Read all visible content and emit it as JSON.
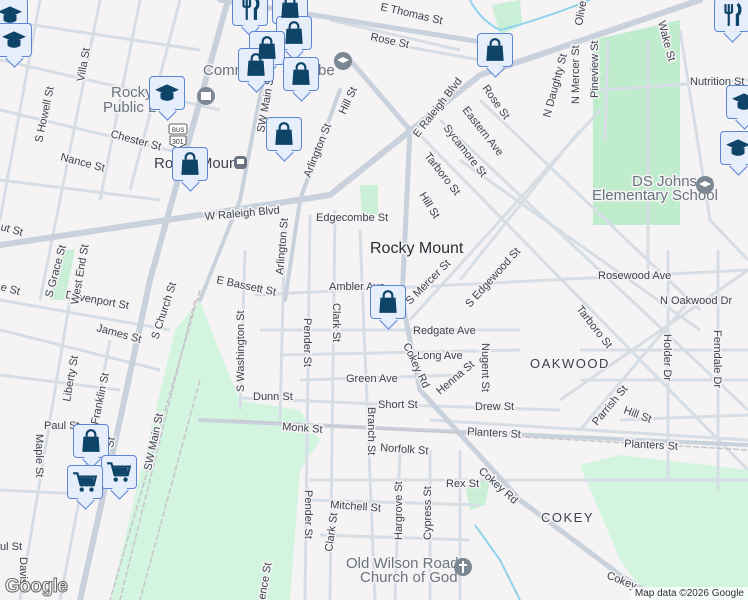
{
  "colors": {
    "background": "#f5f3f3",
    "park": "#c9f0d6",
    "road": "#d3dbe3",
    "major_road": "#c8d1da",
    "water": "#8fd3ee",
    "pin_fill": "#e6edfb",
    "pin_border": "#5b86d6",
    "icon": "#0d4468"
  },
  "place": "Rocky Mount",
  "neighborhoods": {
    "oakwood": "OAKWOOD",
    "cokey": "COKEY"
  },
  "pois": {
    "school_line1": "DS Johnson",
    "school_line2": "Elementary School",
    "church_line1": "Old Wilson Road",
    "church_line2": "Church of God",
    "library_line1": "Rocky",
    "library_line2": "Public L",
    "station": "Rocky Mount",
    "community": "Comm",
    "community_end": "be"
  },
  "route_shield": {
    "top": "BUS",
    "number": "301"
  },
  "streets": {
    "e_thomas": "E Thomas St",
    "rose1": "Rose St",
    "rose2": "Rose St",
    "e_raleigh": "E Raleigh Blvd",
    "eastern": "Eastern Ave",
    "sycamore": "Sycamore St",
    "tarboro1": "Tarboro St",
    "tarboro2": "Tarboro St",
    "hill1": "Hill St",
    "hill2": "Hill St",
    "hill3": "Hill St",
    "daughty": "N Daughty St",
    "n_mercer": "N Mercer St",
    "olive": "Olive St",
    "pineview": "Pineview St",
    "wake": "Wake St",
    "nutrition": "Nutrition St",
    "rosewood": "Rosewood Ave",
    "n_oakwood": "N Oakwood Dr",
    "s_mercer": "S Mercer St",
    "s_edgewood": "S Edgewood St",
    "edgecombe": "Edgecombe St",
    "w_raleigh": "W Raleigh Blvd",
    "arlington1": "Arlington St",
    "arlington2": "Arlington St",
    "chester": "Chester St",
    "nance": "Nance St",
    "s_howell": "S Howell St",
    "villa": "Villa St",
    "sw_main1": "SW Main St",
    "e_bassett": "E Bassett St",
    "ambler": "Ambler Ave",
    "davenport": "Davenport St",
    "james": "James St",
    "s_grace": "S Grace St",
    "west_end": "West End St",
    "s_washington": "S Washington St",
    "pender1": "Pender St",
    "clark1": "Clark St",
    "redgate": "Redgate Ave",
    "long": "Long Ave",
    "green": "Green Ave",
    "henna": "Henna St",
    "nugent": "Nugent St",
    "dunn": "Dunn St",
    "short": "Short St",
    "drew": "Drew St",
    "parrish": "Parrish St",
    "monk": "Monk St",
    "norfolk": "Norfolk St",
    "planters1": "Planters St",
    "planters2": "Planters St",
    "branch": "Branch St",
    "cokey1": "Cokey Rd",
    "cokey2": "Cokey Rd",
    "cokey3": "Cokey",
    "rex": "Rex St",
    "mitchell": "Mitchell St",
    "pender2": "Pender St",
    "clark2": "Clark St",
    "hargrove": "Hargrove St",
    "cypress": "Cypress St",
    "liberty": "Liberty St",
    "franklin": "Franklin St",
    "paul": "Paul St",
    "maple": "Maple St",
    "sw_main2": "SW Main St",
    "s_church": "S Church St",
    "holder": "Holder Dr",
    "ferndale": "Ferndale Dr",
    "ut": "ut St",
    "e_st": "e St",
    "ul_st": "ul St",
    "davis": "Davis",
    "st": "St",
    "pence": "ence St"
  },
  "footer": {
    "logo": "Google",
    "attribution": "Map data ©2026 Google"
  }
}
